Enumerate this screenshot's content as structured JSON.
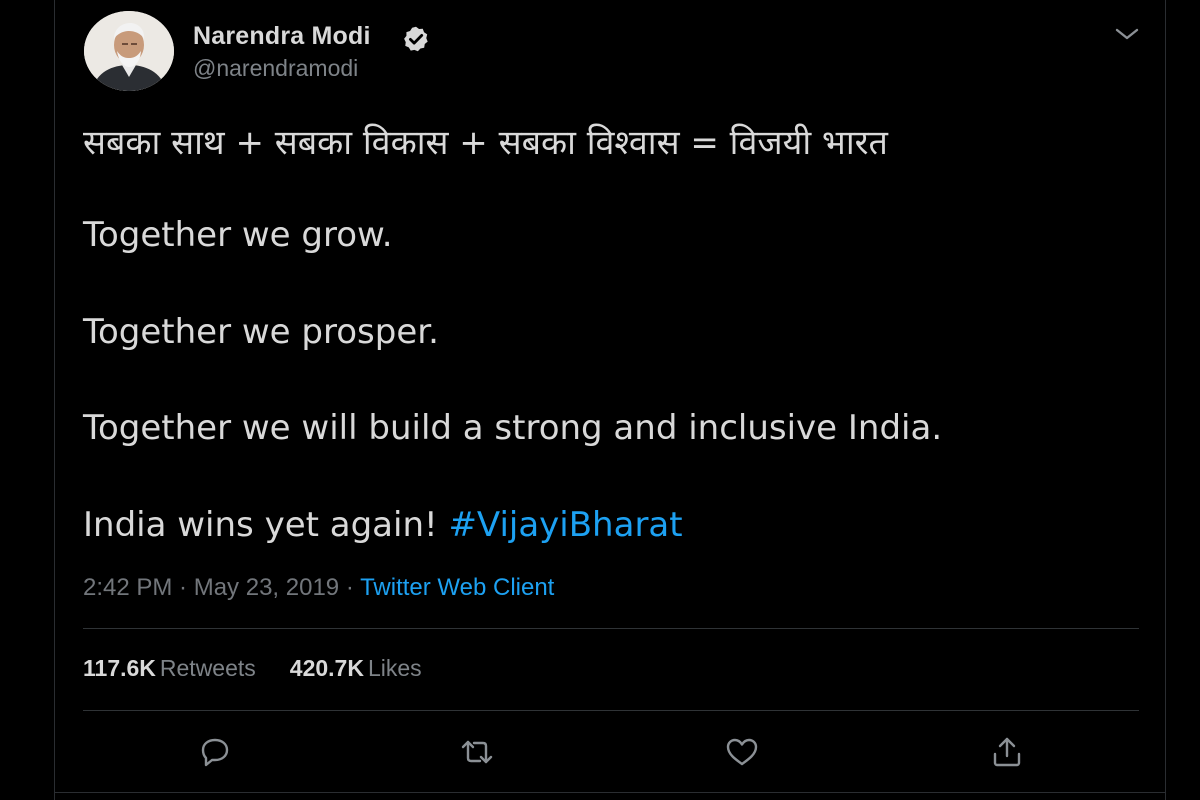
{
  "tweet": {
    "author": {
      "name": "Narendra Modi",
      "handle": "@narendramodi",
      "verified": true,
      "avatar_icon": "profile-photo"
    },
    "lines": {
      "hindi": "सबका साथ + सबका विकास + सबका विश्वास = विजयी भारत",
      "grow": "Together we grow.",
      "prosper": "Together we prosper.",
      "build": "Together we will build a strong and inclusive India.",
      "wins_prefix": "India wins yet again! ",
      "hashtag": "#VijayiBharat"
    },
    "meta": {
      "time": "2:42 PM",
      "separator_1": " · ",
      "date": "May 23, 2019",
      "separator_2": " · ",
      "source": "Twitter Web Client"
    },
    "stats": {
      "retweets_count": "117.6K",
      "retweets_label": "Retweets",
      "likes_count": "420.7K",
      "likes_label": "Likes"
    },
    "actions": {
      "reply_icon": "speech-bubble",
      "retweet_icon": "retweet-arrows",
      "like_icon": "heart",
      "share_icon": "share-upload"
    }
  },
  "colors": {
    "background": "#000000",
    "text": "#d9d9d9",
    "secondary_text": "#7e8388",
    "link": "#1da1f2",
    "divider": "#2f3336"
  }
}
